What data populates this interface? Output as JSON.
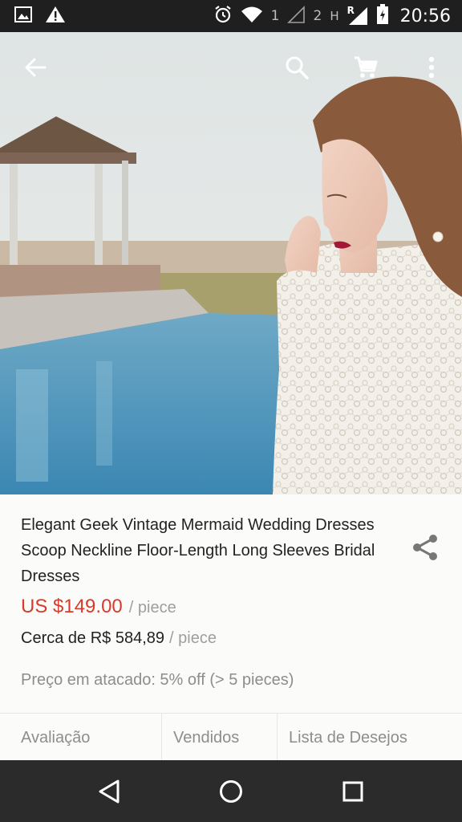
{
  "status_bar": {
    "sim1_label": "1",
    "sim2_label": "2",
    "network_type": "H",
    "roaming_label": "R",
    "time": "20:56",
    "icons": [
      "image-icon",
      "warning-icon",
      "alarm-icon",
      "wifi-icon",
      "signal-icon",
      "battery-icon"
    ]
  },
  "toolbar": {
    "icons": [
      "back-arrow-icon",
      "search-icon",
      "cart-icon",
      "more-vert-icon"
    ]
  },
  "gallery": {
    "image_count": 6,
    "active_index": 2,
    "active_color": "#e62117"
  },
  "product": {
    "title": "Elegant Geek Vintage Mermaid Wedding Dresses Scoop Neckline Floor-Length Long Sleeves Bridal Dresses",
    "price": "US $149.00",
    "price_unit": "/ piece",
    "approx_price": "Cerca de R$ 584,89",
    "approx_unit": "/ piece",
    "wholesale": "Preço em atacado: 5% off (> 5 pieces)",
    "price_color": "#d93a2b"
  },
  "tabs": [
    {
      "label": "Avaliação"
    },
    {
      "label": "Vendidos"
    },
    {
      "label": "Lista de Desejos"
    }
  ],
  "nav_bar": {
    "icons": [
      "back-triangle-icon",
      "home-circle-icon",
      "recents-square-icon"
    ]
  }
}
